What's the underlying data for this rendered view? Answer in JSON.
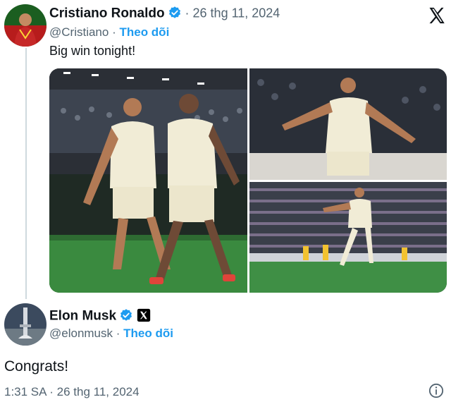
{
  "tweet": {
    "author_name": "Cristiano Ronaldo",
    "handle": "@Cristiano",
    "date": "26 thg 11, 2024",
    "follow_label": "Theo dõi",
    "text": "Big win tonight!",
    "brand_icon": "x-logo-icon"
  },
  "reply": {
    "author_name": "Elon Musk",
    "handle": "@elonmusk",
    "follow_label": "Theo dõi",
    "text": "Congrats!",
    "timestamp": "1:31 SA · 26 thg 11, 2024"
  },
  "colors": {
    "accent": "#1d9bf0",
    "muted": "#536471",
    "verified": "#1d9bf0",
    "pitch": "#2e7d32"
  },
  "icons": [
    "verified-badge-icon",
    "x-affiliate-badge-icon",
    "x-logo-icon",
    "info-icon"
  ]
}
